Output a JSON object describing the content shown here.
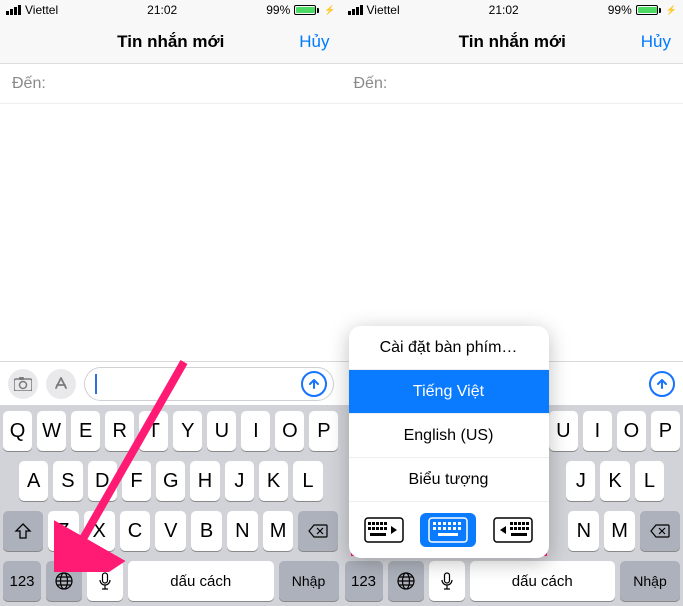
{
  "status": {
    "carrier": "Viettel",
    "time": "21:02",
    "battery_pct": "99%"
  },
  "nav": {
    "title": "Tin nhắn mới",
    "cancel": "Hủy"
  },
  "to_label": "Đến:",
  "icons": {
    "camera": "camera-icon",
    "apps": "app-store-icon",
    "send": "arrow-up-icon",
    "globe": "globe-icon",
    "mic": "mic-icon",
    "shift": "shift-icon",
    "backspace": "backspace-icon"
  },
  "keyboard": {
    "row1": [
      "Q",
      "W",
      "E",
      "R",
      "T",
      "Y",
      "U",
      "I",
      "O",
      "P"
    ],
    "row2": [
      "A",
      "S",
      "D",
      "F",
      "G",
      "H",
      "J",
      "K",
      "L"
    ],
    "row3": [
      "Z",
      "X",
      "C",
      "V",
      "B",
      "N",
      "M"
    ],
    "num": "123",
    "space": "dấu cách",
    "enter": "Nhập"
  },
  "menu": {
    "settings": "Cài đặt bàn phím…",
    "lang_vi": "Tiếng Việt",
    "lang_en": "English (US)",
    "emoji": "Biểu tượng"
  },
  "colors": {
    "accent": "#007aff",
    "annotation": "#ff1a74",
    "battery_fill": "#4cd964"
  }
}
